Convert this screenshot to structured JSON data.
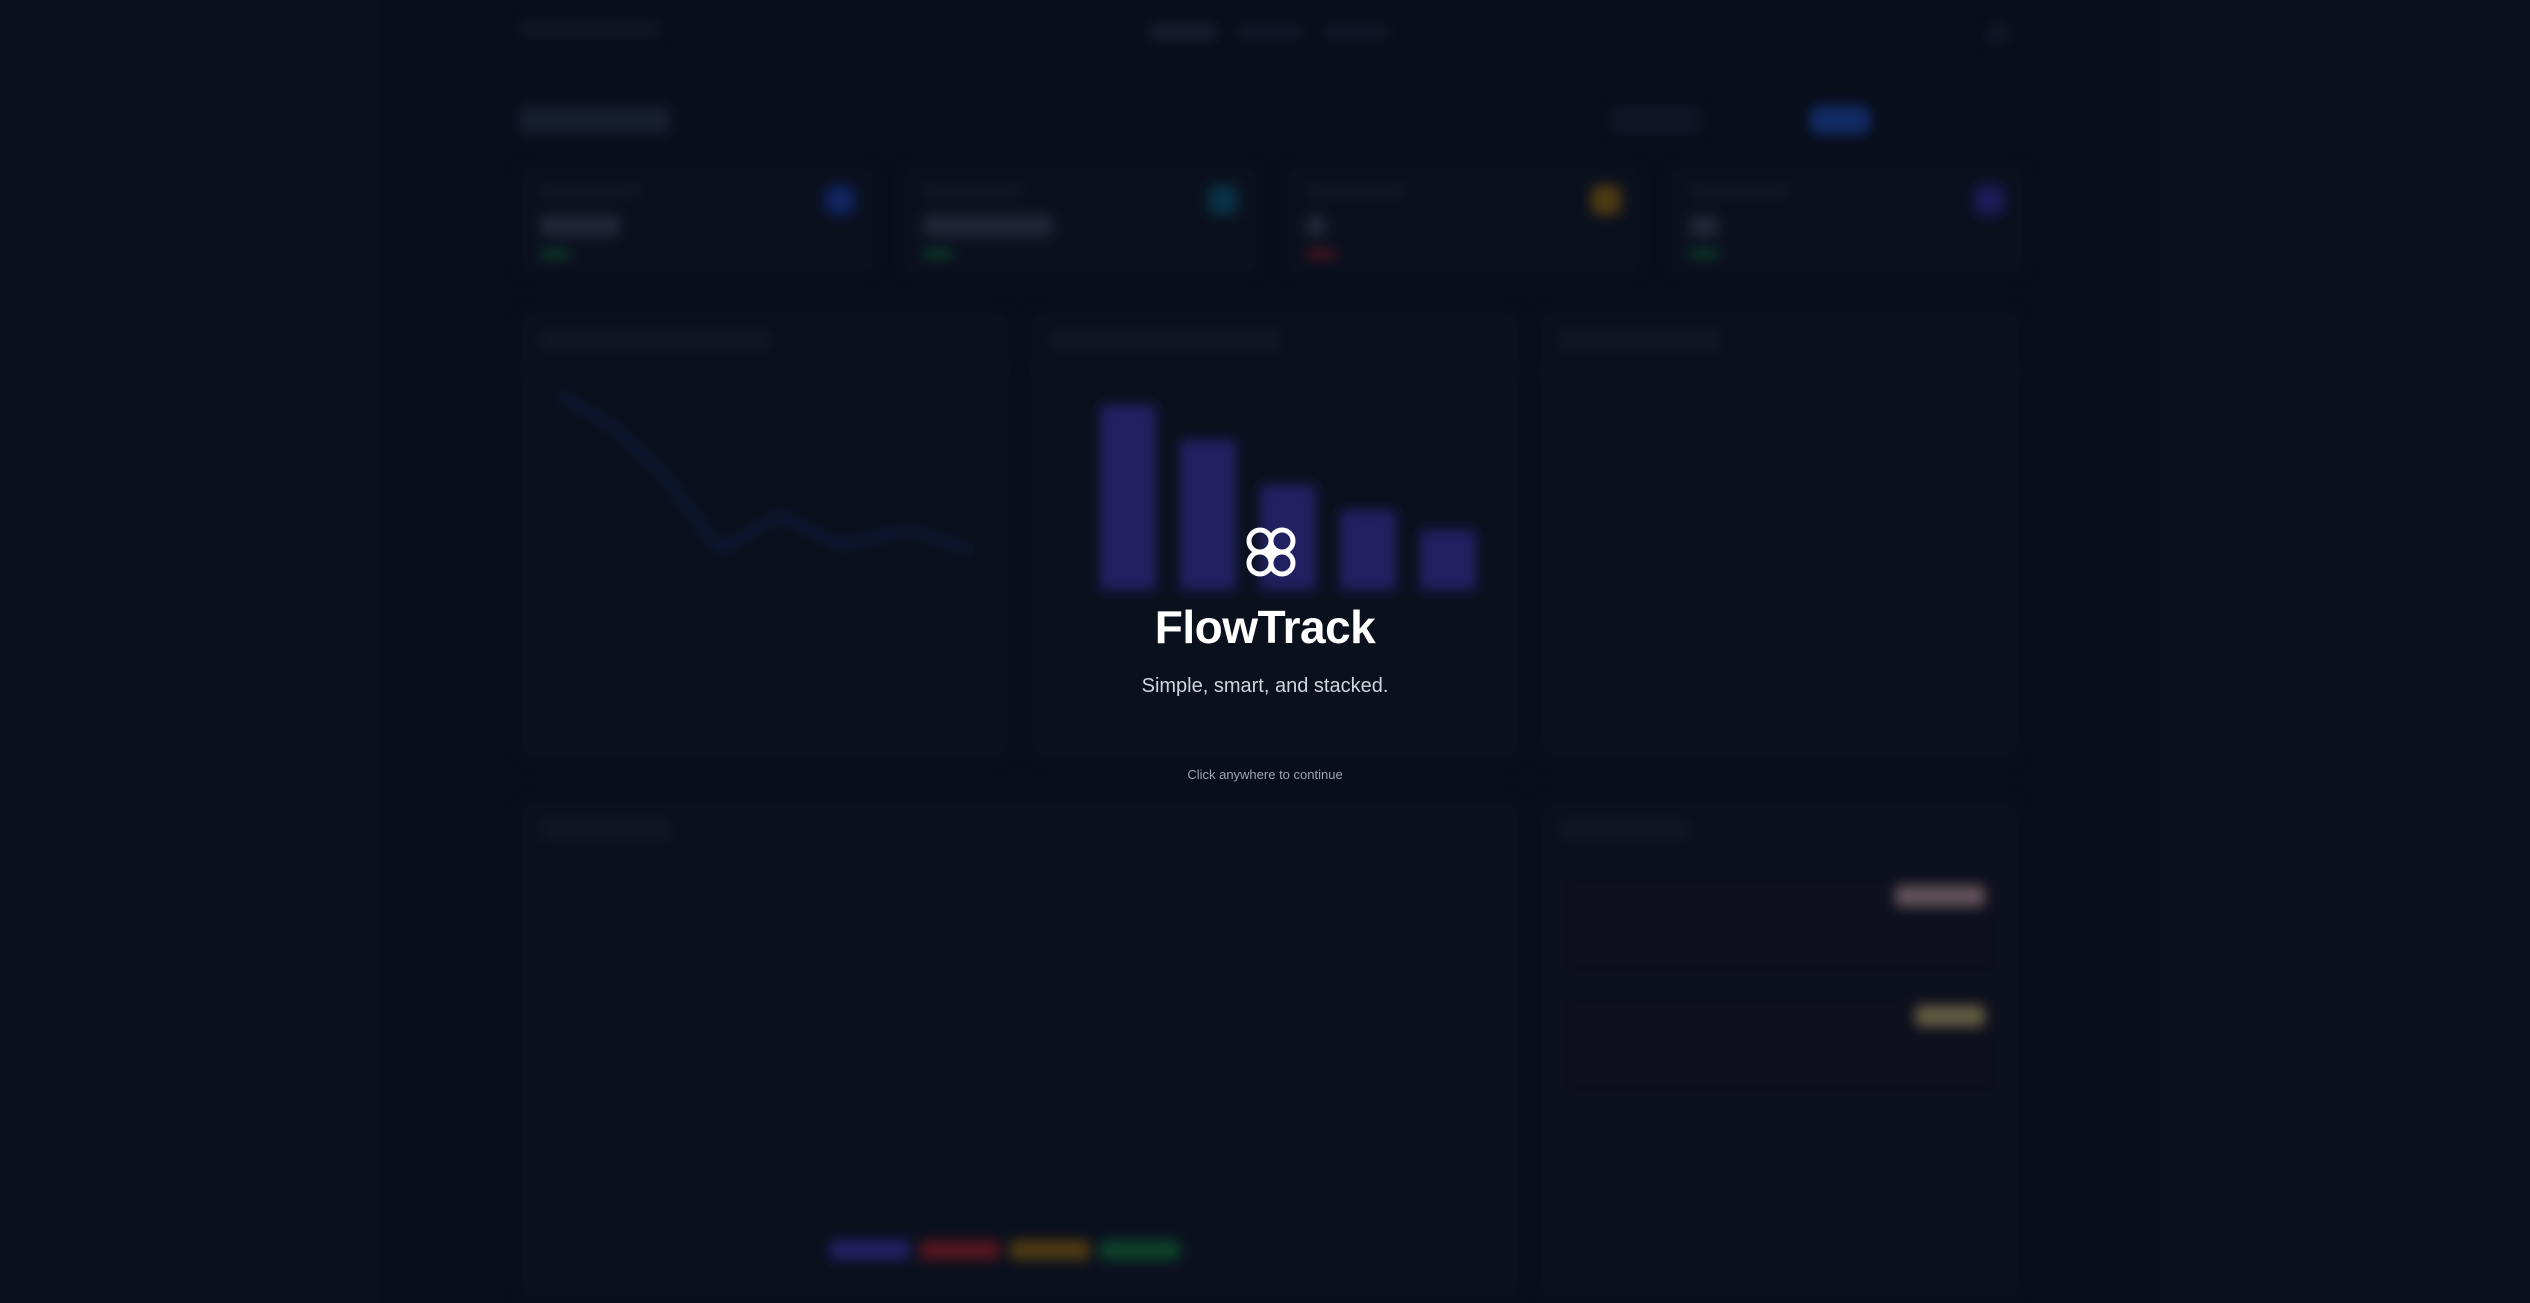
{
  "splash": {
    "logo_icon": "flowtrack-logo-icon",
    "app_name": "FlowTrack",
    "tagline": "Simple, smart, and stacked.",
    "continue_hint": "Click anywhere to continue"
  },
  "colors": {
    "background": "#0b1120",
    "card": "#111827",
    "accent": "#4f46e5",
    "primary_button": "#2563eb",
    "text_primary": "#ffffff",
    "text_secondary": "#d1d5db",
    "text_muted": "#9ca3af"
  }
}
